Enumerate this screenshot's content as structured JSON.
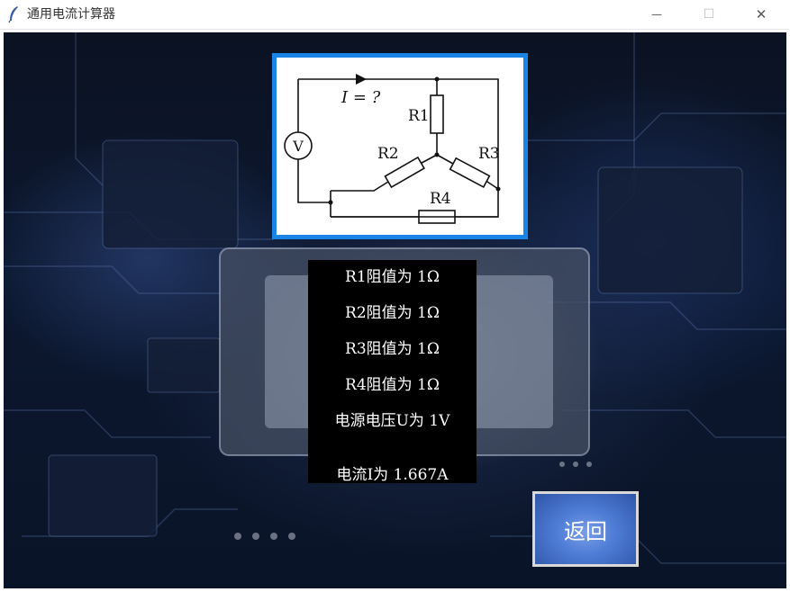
{
  "window": {
    "title": "通用电流计算器",
    "minimize_glyph": "—",
    "maximize_glyph": "☐",
    "close_glyph": "✕"
  },
  "diagram": {
    "current_label": "I = ?",
    "voltmeter_label": "V",
    "resistors": [
      "R1",
      "R2",
      "R3",
      "R4"
    ]
  },
  "results": {
    "r1": "R1阻值为 1Ω",
    "r2": "R2阻值为 1Ω",
    "r3": "R3阻值为 1Ω",
    "r4": "R4阻值为 1Ω",
    "voltage": "电源电压U为 1V",
    "current": "电流I为 1.667A"
  },
  "buttons": {
    "back": "返回"
  },
  "colors": {
    "diagram_border": "#1a83e6",
    "panel_bg": "#000000",
    "button_blue": "#4f7dd6"
  }
}
